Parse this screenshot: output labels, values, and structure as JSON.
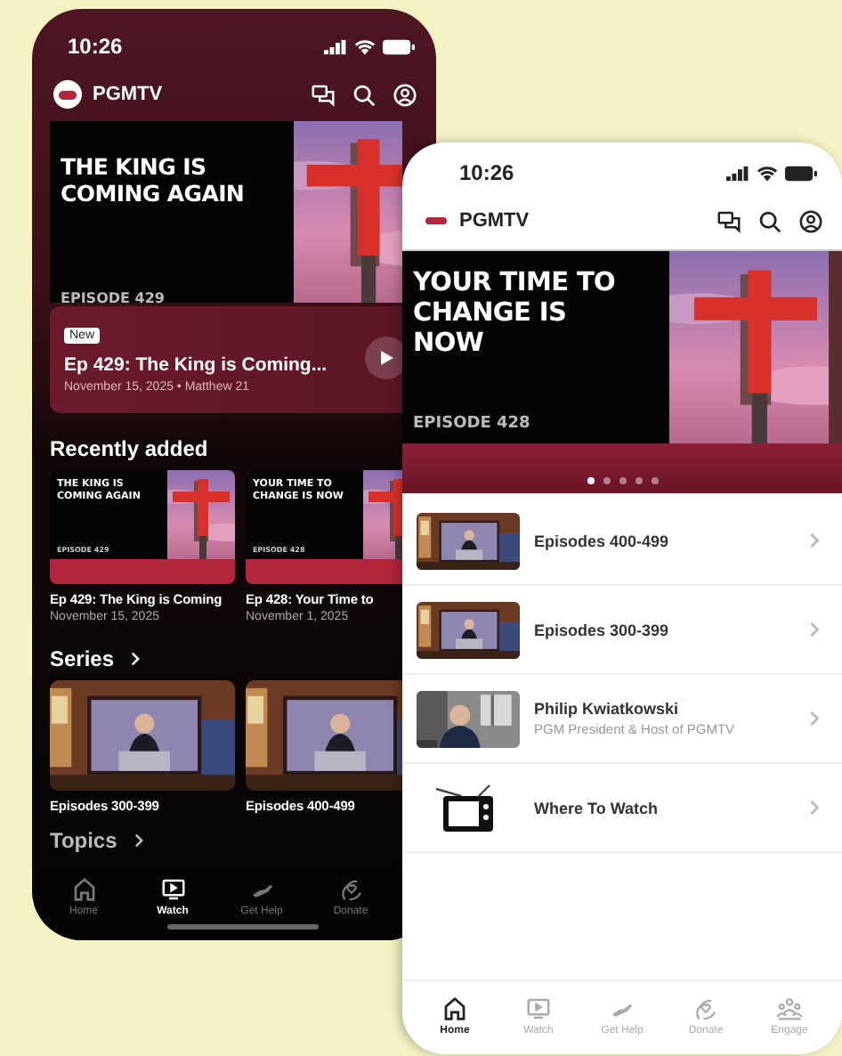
{
  "left_phone": {
    "time": "10:26",
    "brand": "PGMTV",
    "hero": {
      "title": "THE KING IS COMING AGAIN",
      "episode": "EPISODE 429"
    },
    "featured": {
      "badge": "New",
      "title": "Ep 429: The King is Coming...",
      "meta": "November 15, 2025 • Matthew 21"
    },
    "recently_added": {
      "heading": "Recently added",
      "items": [
        {
          "thumb_title": "THE KING IS COMING AGAIN",
          "thumb_episode": "EPISODE 429",
          "title": "Ep 429: The King is Coming",
          "date": "November 15, 2025"
        },
        {
          "thumb_title": "YOUR TIME TO CHANGE IS NOW",
          "thumb_episode": "EPISODE 428",
          "title": "Ep 428: Your Time to",
          "date": "November 1, 2025"
        }
      ]
    },
    "series": {
      "heading": "Series",
      "items": [
        {
          "title": "Episodes 300-399"
        },
        {
          "title": "Episodes 400-499"
        }
      ]
    },
    "topics": {
      "heading": "Topics"
    },
    "tabs": [
      {
        "label": "Home",
        "kind": "home",
        "selected": false
      },
      {
        "label": "Watch",
        "kind": "tv",
        "selected": true
      },
      {
        "label": "Get Help",
        "kind": "help",
        "selected": false
      },
      {
        "label": "Donate",
        "kind": "donate",
        "selected": false
      }
    ]
  },
  "right_phone": {
    "time": "10:26",
    "brand": "PGMTV",
    "hero": {
      "title": "YOUR TIME TO CHANGE IS NOW",
      "episode": "EPISODE 428"
    },
    "carousel_dots": [
      {
        "selected": true
      },
      {
        "selected": false
      },
      {
        "selected": false
      },
      {
        "selected": false
      },
      {
        "selected": false
      }
    ],
    "rows": [
      {
        "kind": "stage",
        "title": "Episodes 400-499"
      },
      {
        "kind": "stage",
        "title": "Episodes 300-399"
      },
      {
        "kind": "person",
        "title": "Philip Kwiatkowski",
        "subtitle": "PGM President & Host of PGMTV"
      },
      {
        "kind": "tv",
        "title": "Where To Watch"
      }
    ],
    "tabs": [
      {
        "label": "Home",
        "kind": "home",
        "selected": true
      },
      {
        "label": "Watch",
        "kind": "tv",
        "selected": false
      },
      {
        "label": "Get Help",
        "kind": "help",
        "selected": false
      },
      {
        "label": "Donate",
        "kind": "donate",
        "selected": false
      },
      {
        "label": "Engage",
        "kind": "people",
        "selected": false
      }
    ]
  }
}
